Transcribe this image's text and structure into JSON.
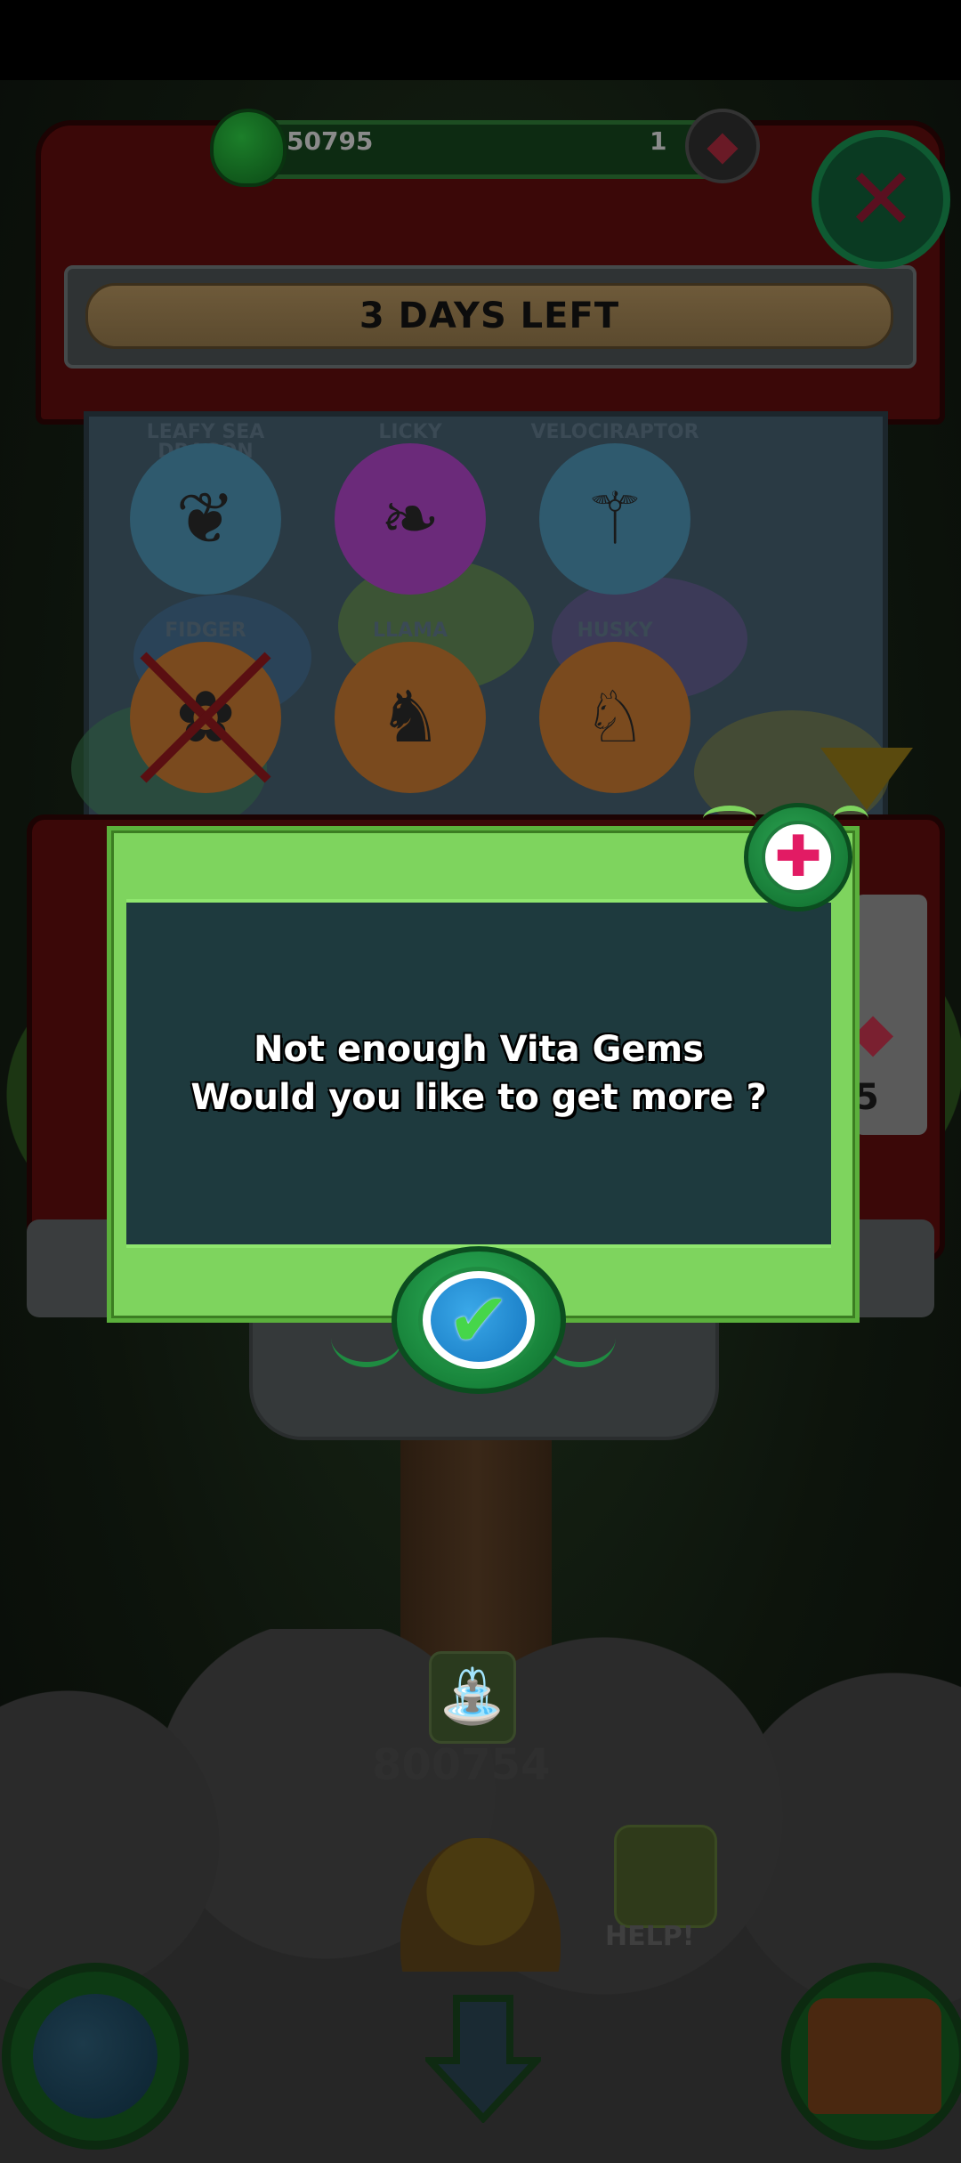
{
  "hud": {
    "coins": "50795",
    "gems": "1",
    "coin_icon": "green-egg-coin-icon",
    "gem_icon": "red-gem-icon"
  },
  "machine": {
    "timer_text": "3 DAYS LEFT",
    "side_count_partial": "5",
    "pets": [
      {
        "name": "LEAFY SEA DRAGON",
        "circle": "#2f5a6e",
        "glyph": "❦",
        "crossed": false
      },
      {
        "name": "LICKY",
        "circle": "#6b2a7a",
        "glyph": "❧",
        "crossed": false
      },
      {
        "name": "VELOCIRAPTOR",
        "circle": "#2f5a6e",
        "glyph": "⚚",
        "crossed": false
      },
      {
        "name": "FIDGER",
        "circle": "#7a4a1e",
        "glyph": "✿",
        "crossed": true
      },
      {
        "name": "LLAMA",
        "circle": "#7a4a1e",
        "glyph": "♞",
        "crossed": false
      },
      {
        "name": "HUSKY",
        "circle": "#7a4a1e",
        "glyph": "♘",
        "crossed": false
      }
    ]
  },
  "dialog": {
    "line1": "Not enough Vita Gems",
    "line2": "Would you like to get more ?",
    "close_icon": "close-x-icon",
    "confirm_icon": "checkmark-icon"
  },
  "bottom": {
    "water_count": "800754",
    "help_label": "HELP!"
  },
  "colors": {
    "dialog_green": "#7ed45e",
    "dialog_panel": "#1e3a3e",
    "close_pink": "#e21b64",
    "check_green": "#46d64a"
  }
}
